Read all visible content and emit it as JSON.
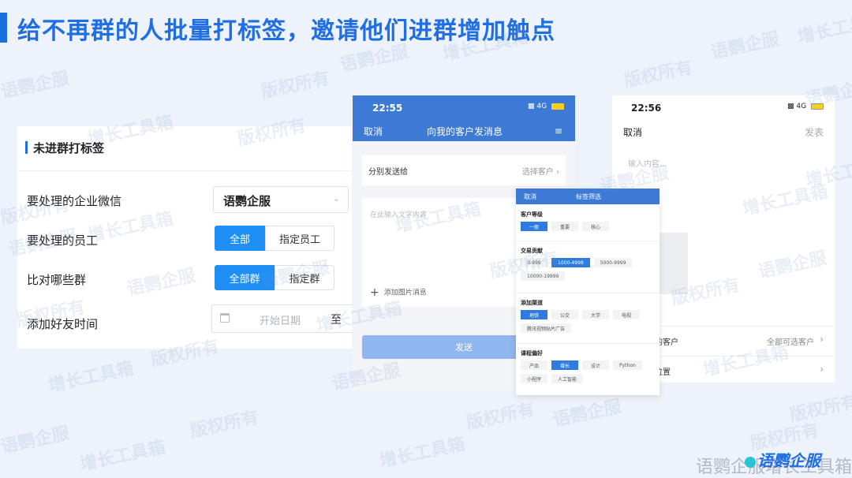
{
  "title": "给不再群的人批量打标签，邀请他们进群增加触点",
  "watermarks": [
    "语鹦企服",
    "增长工具箱",
    "版权所有"
  ],
  "left_panel": {
    "heading": "未进群打标签",
    "rows": {
      "wecom_label": "要处理的企业微信",
      "wecom_value": "语鹦企服",
      "staff_label": "要处理的员工",
      "staff_options": [
        "全部",
        "指定员工"
      ],
      "staff_selected": "全部",
      "groups_label": "比对哪些群",
      "groups_options": [
        "全部群",
        "指定群"
      ],
      "groups_selected": "全部群",
      "time_label": "添加好友时间",
      "time_placeholder": "开始日期",
      "time_to": "至"
    }
  },
  "phone1": {
    "time": "22:55",
    "network": "4G",
    "cancel": "取消",
    "title": "向我的客户发消息",
    "row_label": "分别发送给",
    "row_value": "选择客户",
    "msg_placeholder": "在此输入文字内容",
    "add_image": "添加图片消息",
    "send": "发送"
  },
  "phone2": {
    "time": "22:56",
    "network": "4G",
    "cancel": "取消",
    "publish": "发表",
    "input_placeholder": "输入内容...",
    "row1_label": "的客户",
    "row1_value": "全部可选客户",
    "row2_label": "位置"
  },
  "tag_panel": {
    "cancel": "取消",
    "title": "标签筛选",
    "sections": [
      {
        "name": "客户等级",
        "tags": [
          "一般",
          "重要",
          "核心"
        ],
        "selected": "一般"
      },
      {
        "name": "交易贡献",
        "tags": [
          "0-999",
          "1000-4999",
          "5000-9999",
          "10000-19999"
        ],
        "selected": "1000-4999"
      },
      {
        "name": "添加渠道",
        "tags": [
          "地铁",
          "公交",
          "大学",
          "电视",
          "腾讯视频贴片广告"
        ],
        "selected": "地铁"
      },
      {
        "name": "课程偏好",
        "tags": [
          "产品",
          "增长",
          "设计",
          "Python",
          "小程序",
          "人工智能"
        ],
        "selected": "增长"
      }
    ]
  },
  "footer": {
    "brand_text": "语鹦企服增长工具箱",
    "brand_logo": "语鹦企服"
  }
}
